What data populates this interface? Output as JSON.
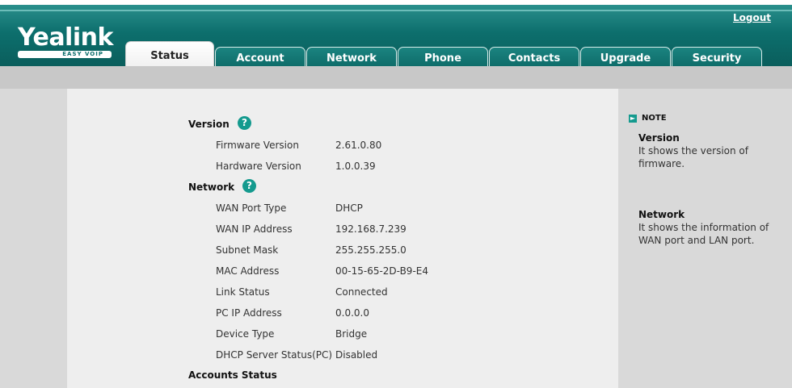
{
  "header": {
    "logo_text": "Yealink",
    "logo_subtitle": "EASY VOIP",
    "logout_label": "Logout"
  },
  "tabs": [
    {
      "label": "Status",
      "active": true
    },
    {
      "label": "Account",
      "active": false
    },
    {
      "label": "Network",
      "active": false
    },
    {
      "label": "Phone",
      "active": false
    },
    {
      "label": "Contacts",
      "active": false
    },
    {
      "label": "Upgrade",
      "active": false
    },
    {
      "label": "Security",
      "active": false
    }
  ],
  "sections": {
    "version": {
      "title": "Version",
      "help_icon": "?",
      "rows": [
        {
          "label": "Firmware Version",
          "value": "2.61.0.80"
        },
        {
          "label": "Hardware Version",
          "value": "1.0.0.39"
        }
      ]
    },
    "network": {
      "title": "Network",
      "help_icon": "?",
      "rows": [
        {
          "label": "WAN Port Type",
          "value": "DHCP"
        },
        {
          "label": "WAN IP Address",
          "value": "192.168.7.239"
        },
        {
          "label": "Subnet Mask",
          "value": "255.255.255.0"
        },
        {
          "label": "MAC Address",
          "value": "00-15-65-2D-B9-E4"
        },
        {
          "label": "Link Status",
          "value": "Connected"
        },
        {
          "label": "PC IP Address",
          "value": "0.0.0.0"
        },
        {
          "label": "Device Type",
          "value": "Bridge"
        },
        {
          "label": "DHCP Server Status(PC)",
          "value": "Disabled"
        }
      ]
    },
    "accounts": {
      "title": "Accounts Status"
    }
  },
  "note": {
    "heading": "NOTE",
    "items": [
      {
        "title": "Version",
        "text": "It shows the version of firmware."
      },
      {
        "title": "Network",
        "text": "It shows the information of WAN port and LAN port."
      }
    ]
  },
  "colors": {
    "header_teal": "#0d6f6d",
    "help_icon_teal": "#149a8e",
    "content_bg": "#eeeeee",
    "side_bg": "#d9d9d9"
  }
}
